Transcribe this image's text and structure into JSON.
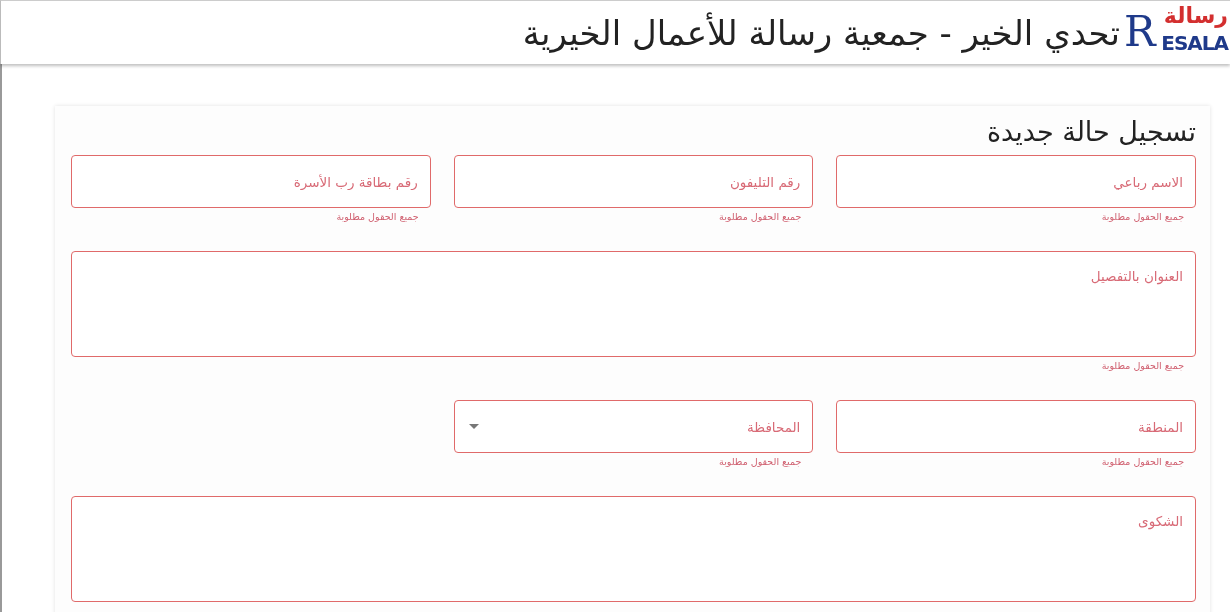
{
  "header": {
    "title": "تحدي الخير - جمعية رسالة للأعمال الخيرية",
    "logo": {
      "arabic": "رسالة",
      "initial": "R",
      "latin": "ESALA"
    }
  },
  "form": {
    "title": "تسجيل حالة جديدة",
    "fields": [
      {
        "kind": "input",
        "placeholder": "الاسم رباعي",
        "helper": "جميع الحقول مطلوبة"
      },
      {
        "kind": "input",
        "placeholder": "رقم التليفون",
        "helper": "جميع الحقول مطلوبة"
      },
      {
        "kind": "input",
        "placeholder": "رقم بطاقة رب الأسرة",
        "helper": "جميع الحقول مطلوبة"
      },
      {
        "kind": "textarea",
        "placeholder": "العنوان بالتفصيل",
        "helper": "جميع الحقول مطلوبة"
      },
      {
        "kind": "input",
        "placeholder": "المنطقة",
        "helper": "جميع الحقول مطلوبة"
      },
      {
        "kind": "select",
        "placeholder": "المحافظة",
        "helper": "جميع الحقول مطلوبة"
      },
      {
        "kind": "spacer"
      },
      {
        "kind": "textarea",
        "placeholder": "الشكوى"
      }
    ]
  }
}
